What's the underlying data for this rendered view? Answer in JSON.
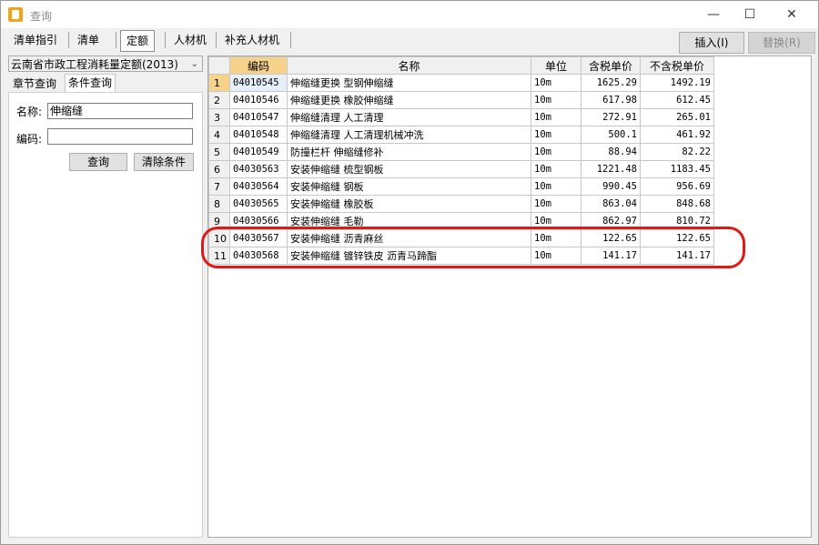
{
  "window": {
    "title": "查询",
    "minimize": "—",
    "maximize": "☐",
    "close": "✕"
  },
  "toolbar": {
    "tabs": [
      "清单指引",
      "清单",
      "定额",
      "人材机",
      "补充人材机"
    ],
    "active_tab": 2,
    "insert_label": "插入(I)",
    "replace_label": "替换(R)"
  },
  "left": {
    "database": "云南省市政工程消耗量定额(2013)",
    "tabs": [
      "章节查询",
      "条件查询"
    ],
    "active_tab": 1,
    "name_label": "名称:",
    "name_value": "伸缩缝",
    "code_label": "编码:",
    "code_value": "",
    "query_button": "查询",
    "clear_button": "清除条件"
  },
  "grid": {
    "columns": [
      "编码",
      "名称",
      "单位",
      "含税单价",
      "不含税单价"
    ],
    "rows": [
      {
        "no": "1",
        "code": "04010545",
        "name": "伸缩缝更换 型钢伸缩缝",
        "unit": "10m",
        "price_tax": "1625.29",
        "price_notax": "1492.19"
      },
      {
        "no": "2",
        "code": "04010546",
        "name": "伸缩缝更换 橡胶伸缩缝",
        "unit": "10m",
        "price_tax": "617.98",
        "price_notax": "612.45"
      },
      {
        "no": "3",
        "code": "04010547",
        "name": "伸缩缝清理 人工清理",
        "unit": "10m",
        "price_tax": "272.91",
        "price_notax": "265.01"
      },
      {
        "no": "4",
        "code": "04010548",
        "name": "伸缩缝清理 人工清理机械冲洗",
        "unit": "10m",
        "price_tax": "500.1",
        "price_notax": "461.92"
      },
      {
        "no": "5",
        "code": "04010549",
        "name": "防撞栏杆 伸缩缝修补",
        "unit": "10m",
        "price_tax": "88.94",
        "price_notax": "82.22"
      },
      {
        "no": "6",
        "code": "04030563",
        "name": "安装伸缩缝 梳型钢板",
        "unit": "10m",
        "price_tax": "1221.48",
        "price_notax": "1183.45"
      },
      {
        "no": "7",
        "code": "04030564",
        "name": "安装伸缩缝 钢板",
        "unit": "10m",
        "price_tax": "990.45",
        "price_notax": "956.69"
      },
      {
        "no": "8",
        "code": "04030565",
        "name": "安装伸缩缝 橡胶板",
        "unit": "10m",
        "price_tax": "863.04",
        "price_notax": "848.68"
      },
      {
        "no": "9",
        "code": "04030566",
        "name": "安装伸缩缝 毛勒",
        "unit": "10m",
        "price_tax": "862.97",
        "price_notax": "810.72"
      },
      {
        "no": "10",
        "code": "04030567",
        "name": "安装伸缩缝 沥青麻丝",
        "unit": "10m",
        "price_tax": "122.65",
        "price_notax": "122.65"
      },
      {
        "no": "11",
        "code": "04030568",
        "name": "安装伸缩缝 镀锌铁皮 沥青马蹄酯",
        "unit": "10m",
        "price_tax": "141.17",
        "price_notax": "141.17"
      }
    ],
    "selected_row": 0
  },
  "colors": {
    "accent_header": "#f7d28b",
    "annotation": "#e01818"
  }
}
